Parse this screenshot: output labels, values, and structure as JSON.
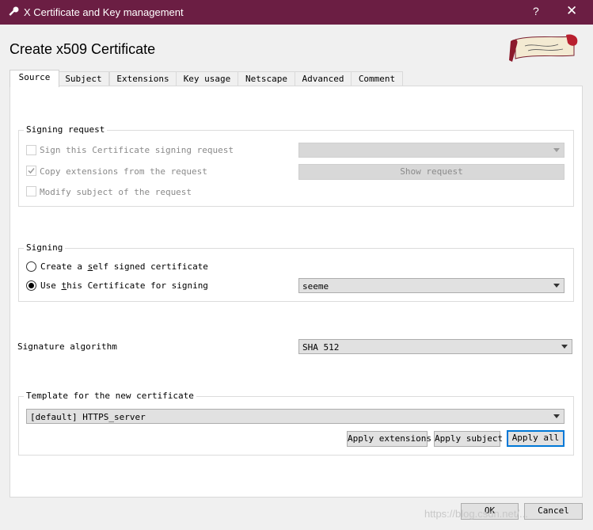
{
  "window": {
    "title": "X Certificate and Key management",
    "help_glyph": "?",
    "close_glyph": "✕"
  },
  "dialog": {
    "heading": "Create x509 Certificate"
  },
  "tabs": [
    {
      "label": "Source",
      "active": true
    },
    {
      "label": "Subject",
      "active": false
    },
    {
      "label": "Extensions",
      "active": false
    },
    {
      "label": "Key usage",
      "active": false
    },
    {
      "label": "Netscape",
      "active": false
    },
    {
      "label": "Advanced",
      "active": false
    },
    {
      "label": "Comment",
      "active": false
    }
  ],
  "signing_request": {
    "legend": "Signing request",
    "sign_csr_label": "Sign this Certificate signing request",
    "sign_csr_checked": false,
    "copy_ext_label": "Copy extensions from the request",
    "copy_ext_checked": true,
    "modify_subject_label": "Modify subject of the request",
    "modify_subject_checked": false,
    "request_select_value": "",
    "show_request_label": "Show request"
  },
  "signing": {
    "legend": "Signing",
    "self_signed_label_pre": "Create a ",
    "self_signed_label_ul": "s",
    "self_signed_label_post": "elf signed certificate",
    "self_signed_selected": false,
    "use_cert_label_pre": "Use ",
    "use_cert_label_ul": "t",
    "use_cert_label_post": "his Certificate for signing",
    "use_cert_selected": true,
    "signer_value": "seeme"
  },
  "signature": {
    "label": "Signature algorithm",
    "value": "SHA 512"
  },
  "template": {
    "legend": "Template for the new certificate",
    "value": "[default] HTTPS_server",
    "apply_extensions_label": "Apply extensions",
    "apply_subject_label": "Apply subject",
    "apply_all_label": "Apply all"
  },
  "footer": {
    "ok_label": "OK",
    "cancel_label": "Cancel",
    "watermark": "https://blog.csdn.net/..."
  }
}
